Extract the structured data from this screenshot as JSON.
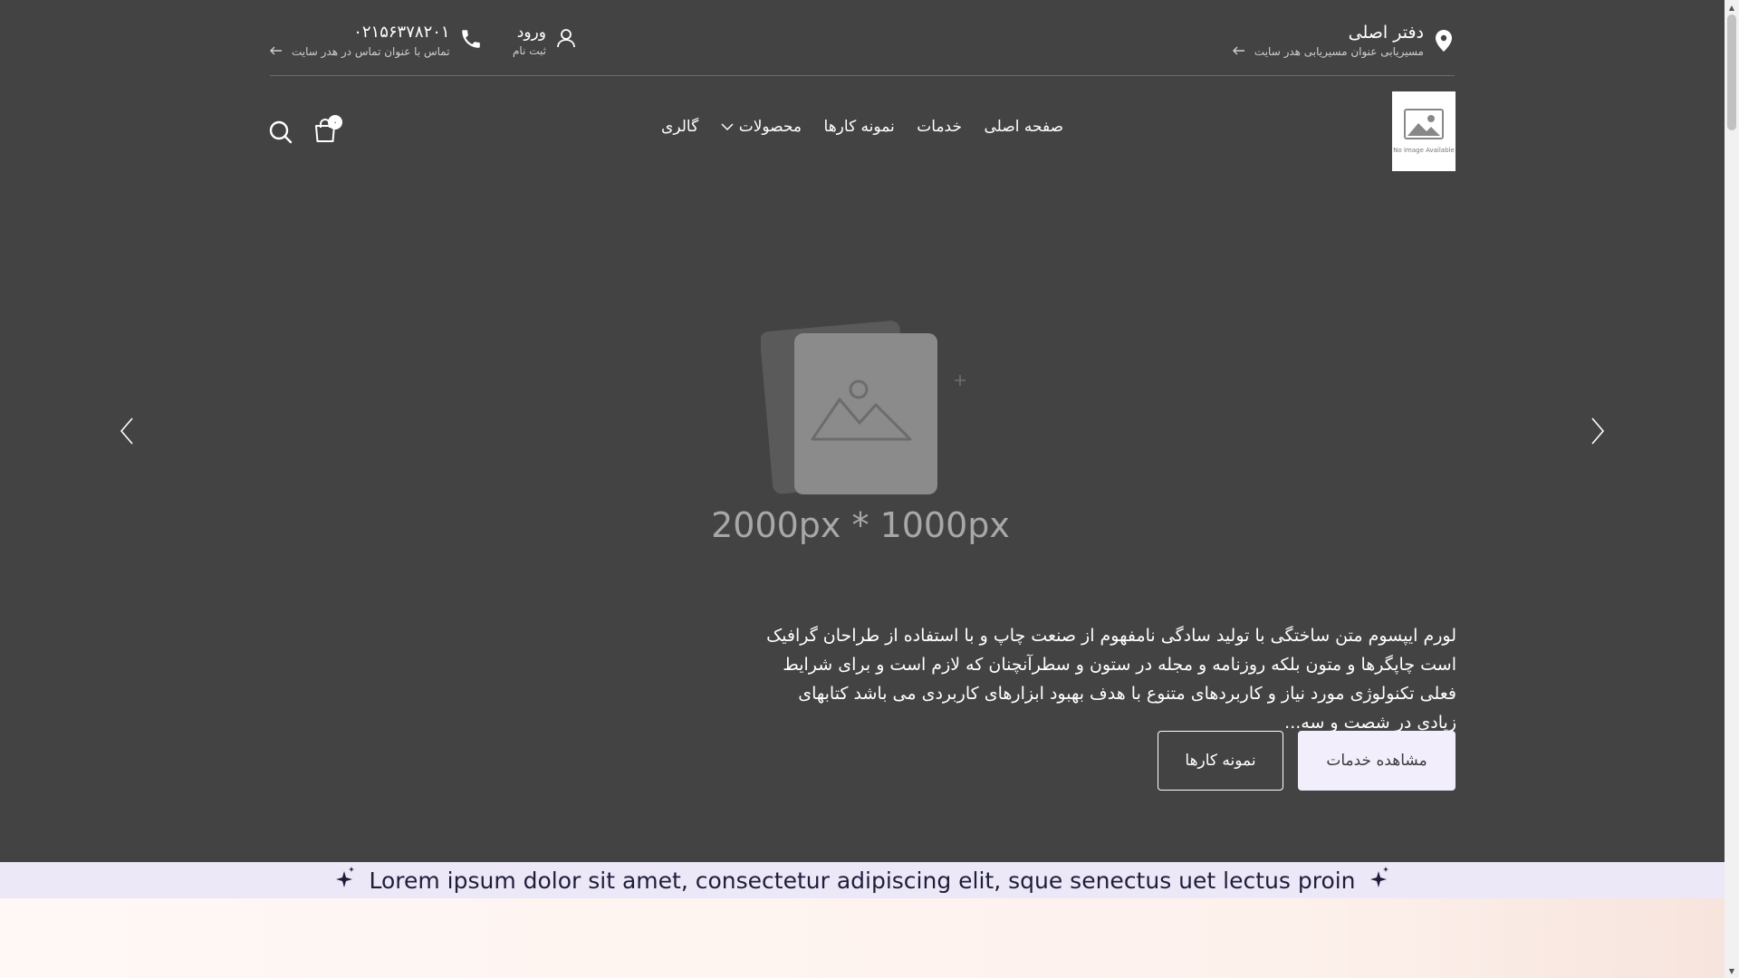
{
  "topbar": {
    "office_title": "دفتر اصلی",
    "office_sub": "مسیریابی عنوان مسیریابی هدر سایت",
    "phone": "۰۲۱۵۶۳۷۸۲۰۱",
    "phone_sub": "تماس با عنوان تماس در هدر سایت",
    "login_label": "ورود",
    "register_label": "ثبت نام"
  },
  "logo": {
    "no_image_text": "No Image Available"
  },
  "nav": {
    "items": [
      "صفحه اصلی",
      "خدمات",
      "نمونه کارها",
      "محصولات",
      "گالری"
    ]
  },
  "cart": {
    "count": "۰"
  },
  "hero": {
    "placeholder_size": "2000px * 1000px",
    "text": "لورم ایپسوم متن ساختگی با تولید سادگی نامفهوم از صنعت چاپ و با استفاده از طراحان گرافیک است چاپگرها و متون بلکه روزنامه و مجله در ستون و سطرآنچنان که لازم است و برای شرایط فعلی تکنولوژی مورد نیاز و کاربردهای متنوع با هدف بهبود ابزارهای کاربردی می باشد کتابهای زیادی در شصت و سه...",
    "primary_button": "مشاهده خدمات",
    "secondary_button": "نمونه کارها"
  },
  "strip": {
    "text": "Lorem ipsum dolor sit amet, consectetur adipiscing elit, sque senectus uet lectus proin"
  },
  "colors": {
    "hero_bg": "#434343",
    "strip_bg": "#ede8f8",
    "button_bg": "#f2eefb"
  }
}
